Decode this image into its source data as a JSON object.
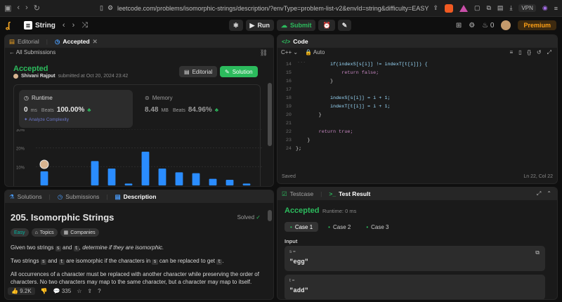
{
  "browser": {
    "url": "leetcode.com/problems/isomorphic-strings/description/?envType=problem-list-v2&envId=string&difficulty=EASY",
    "vpn_label": "VPN"
  },
  "app": {
    "problem_list_label": "String",
    "run_label": "Run",
    "submit_label": "Submit",
    "streak_count": "0",
    "premium_label": "Premium"
  },
  "left_panel": {
    "tabs": [
      "Editorial",
      "Accepted"
    ],
    "all_submissions": "All Submissions",
    "status": "Accepted",
    "author": "Shivani Rajput",
    "submitted_at": "submitted at Oct 20, 2024 23:42",
    "editorial_btn": "Editorial",
    "solution_btn": "Solution",
    "runtime_label": "Runtime",
    "runtime_value": "0",
    "runtime_unit": "ms",
    "runtime_beats_label": "Beats",
    "runtime_beats": "100.00%",
    "analyze": "Analyze Complexity",
    "memory_label": "Memory",
    "memory_value": "8.48",
    "memory_unit": "MB",
    "memory_beats_label": "Beats",
    "memory_beats": "84.96%"
  },
  "chart_data": {
    "type": "bar",
    "y_tick_labels": [
      "30%",
      "20%",
      "10%"
    ],
    "ylim": [
      0,
      30
    ],
    "values": [
      7.5,
      0,
      0,
      13,
      9,
      1,
      18,
      9,
      7,
      6.5,
      3.5,
      3,
      1
    ],
    "highlight_color": "#2a8cff"
  },
  "desc_panel": {
    "tabs": [
      "Solutions",
      "Submissions",
      "Description"
    ],
    "title": "205. Isomorphic Strings",
    "solved": "Solved",
    "chips": [
      "Easy",
      "Topics",
      "Companies"
    ],
    "p1_a": "Given two strings ",
    "p1_s": "s",
    "p1_and": " and ",
    "p1_t": "t",
    "p1_b": ", determine if they are isomorphic.",
    "p2_a": "Two strings ",
    "p2_s": "s",
    "p2_and": " and ",
    "p2_t": "t",
    "p2_b": " are isomorphic if the characters in ",
    "p2_s2": "s",
    "p2_c": " can be replaced to get ",
    "p2_t2": "t",
    "p2_d": ".",
    "p3": "All occurrences of a character must be replaced with another character while preserving the order of characters. No two characters may map to the same character, but a character may map to itself.",
    "likes": "9.2K",
    "comments": "335"
  },
  "code_panel": {
    "title": "Code",
    "language": "C++",
    "mode": "Auto",
    "status": "Saved",
    "cursor": "Ln 22, Col 22",
    "lines": [
      {
        "n": "14",
        "code": "            if(indexS[s[i]] != indexT[t[i]]) {"
      },
      {
        "n": "15",
        "code": "                return false;"
      },
      {
        "n": "16",
        "code": "            }"
      },
      {
        "n": "17",
        "code": ""
      },
      {
        "n": "18",
        "code": "            indexS[s[i]] = i + 1;"
      },
      {
        "n": "19",
        "code": "            indexT[t[i]] = i + 1;"
      },
      {
        "n": "20",
        "code": "        }"
      },
      {
        "n": "21",
        "code": ""
      },
      {
        "n": "22",
        "code": "        return true;"
      },
      {
        "n": "23",
        "code": "    }"
      },
      {
        "n": "24",
        "code": "};"
      }
    ]
  },
  "test_panel": {
    "tabs": [
      "Testcase",
      "Test Result"
    ],
    "status": "Accepted",
    "runtime": "Runtime: 0 ms",
    "cases": [
      "Case 1",
      "Case 2",
      "Case 3"
    ],
    "input_label": "Input",
    "s_label": "s =",
    "s_value": "\"egg\"",
    "t_label": "t =",
    "t_value": "\"add\""
  }
}
